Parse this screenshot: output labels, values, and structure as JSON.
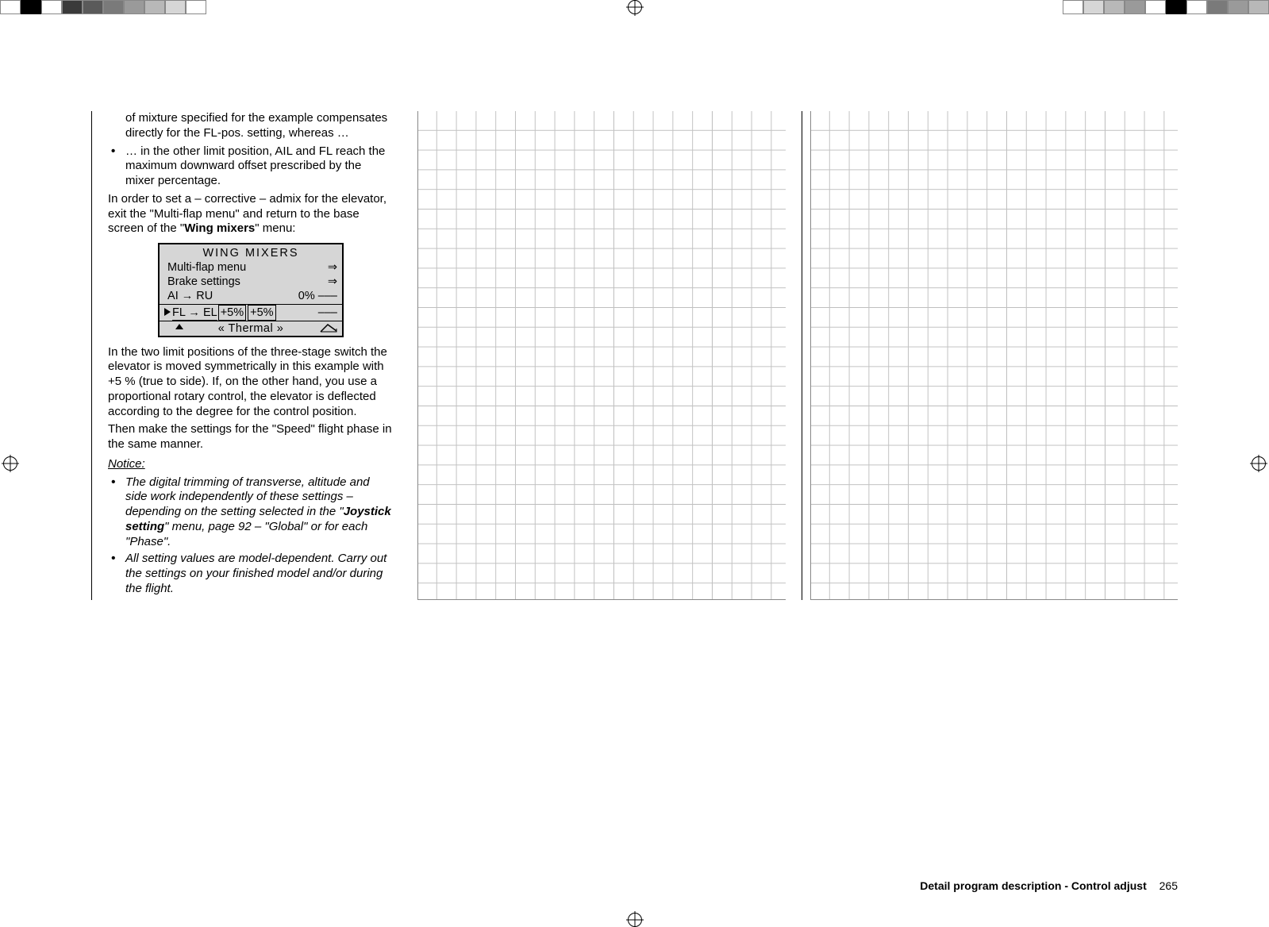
{
  "intro": {
    "l1": "of mixture specified for the example compensates directly for the FL-pos. setting, whereas …",
    "bullet1": "… in the other limit position, AIL and FL reach the maximum downward offset prescribed by the mixer percentage.",
    "para2a": "In order to set a  – corrective – admix for the elevator, exit the \"Multi-flap menu\" and return to the base screen of the \"",
    "para2b": "Wing mixers",
    "para2c": "\" menu:"
  },
  "lcd": {
    "title": "WING  MIXERS",
    "row1_label": "Multi-flap menu",
    "row1_val": "⇒",
    "row2_label": "Brake settings",
    "row2_val": "⇒",
    "row3_label": "AI",
    "row3_arrow": " → ",
    "row3_target": "RU",
    "row3_v1": "0%",
    "row3_v2": "–––",
    "row4_label": "FL",
    "row4_arrow": " → ",
    "row4_target": "EL",
    "row4_v1": "+5%",
    "row4_v2": "+5%",
    "row4_v3": "–––",
    "phase": "« Thermal »"
  },
  "after": {
    "p1": "In the two limit positions of the three-stage switch the elevator is moved symmetrically in this example with +5 % (true to side). If, on the other hand, you use a proportional rotary control, the elevator is deflected according to the degree for the control position.",
    "p2": "Then make the settings for the \"Speed\" flight phase in the same manner.",
    "notice_h": "Notice:",
    "n1a": "The digital trimming of transverse, altitude and side work independently of these settings – depending on the setting selected in the \"",
    "n1b": "Joystick setting",
    "n1c": "\" menu, page 92 – \"Global\" or for each \"Phase\".",
    "n2": "All setting values are model-dependent. Carry out the settings on your finished model and/or during the flight."
  },
  "footer": {
    "title": "Detail program description - Control adjust",
    "page": "265"
  }
}
